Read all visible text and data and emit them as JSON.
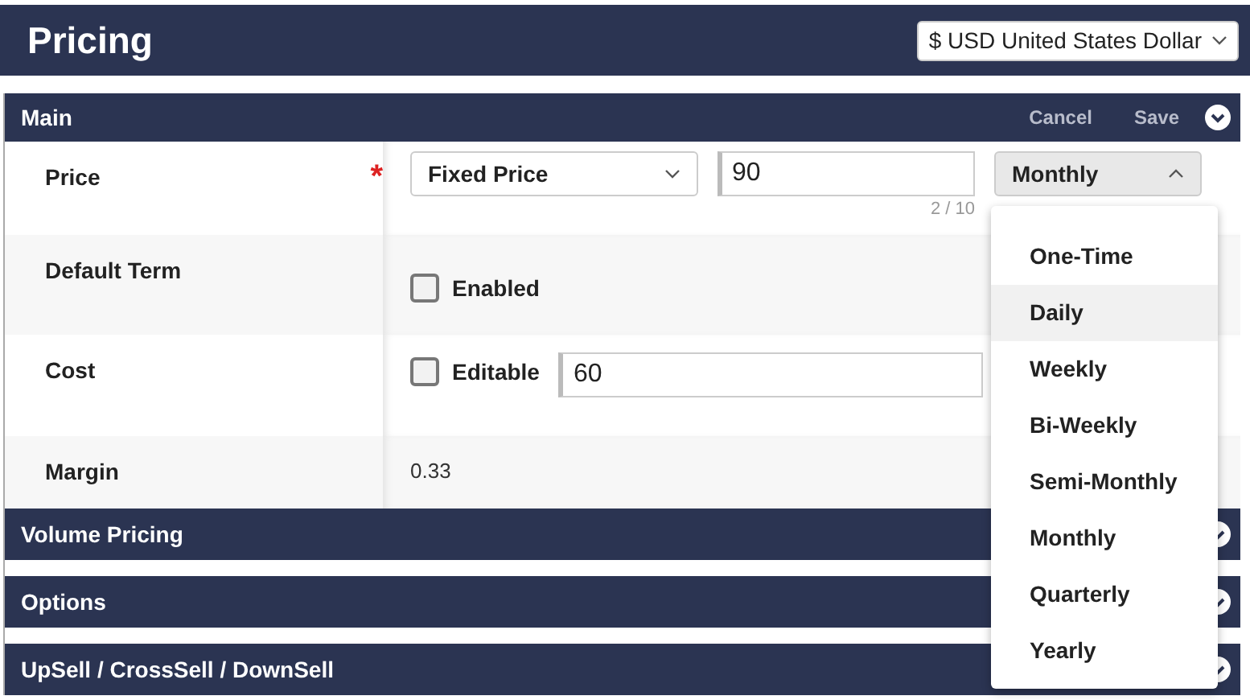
{
  "header": {
    "title": "Pricing",
    "currency": "$ USD United States Dollar"
  },
  "main": {
    "title": "Main",
    "actions": [
      "Cancel",
      "Save"
    ],
    "price": {
      "label": "Price",
      "required_mark": "*",
      "type": "Fixed Price",
      "value": "90",
      "counter": "2 / 10",
      "term": "Monthly",
      "term_open": true
    },
    "default_term": {
      "label": "Default Term",
      "checkbox": "Enabled",
      "checked": false
    },
    "cost": {
      "label": "Cost",
      "checkbox": "Editable",
      "checked": false,
      "value": "60"
    },
    "margin": {
      "label": "Margin",
      "value": "0.33"
    }
  },
  "term_options": [
    {
      "label": "One-Time",
      "highlighted": false
    },
    {
      "label": "Daily",
      "highlighted": true
    },
    {
      "label": "Weekly",
      "highlighted": false
    },
    {
      "label": "Bi-Weekly",
      "highlighted": false
    },
    {
      "label": "Semi-Monthly",
      "highlighted": false
    },
    {
      "label": "Monthly",
      "highlighted": false
    },
    {
      "label": "Quarterly",
      "highlighted": false
    },
    {
      "label": "Yearly",
      "highlighted": false
    }
  ],
  "sections": [
    {
      "title": "Volume Pricing"
    },
    {
      "title": "Options"
    },
    {
      "title": "UpSell / CrossSell / DownSell"
    }
  ]
}
